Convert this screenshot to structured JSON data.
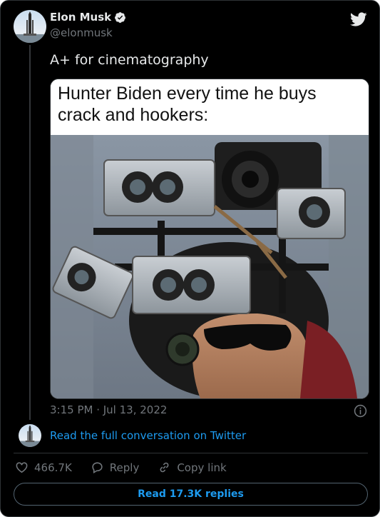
{
  "author": {
    "name": "Elon Musk",
    "handle": "@elonmusk",
    "verified": true,
    "avatar_icon": "rocket-launch-avatar"
  },
  "brand_icon": "twitter-bird-icon",
  "tweet": {
    "text": "A+ for cinematography",
    "media": {
      "caption": "Hunter Biden every time he buys crack and hookers:"
    },
    "timestamp": "3:15 PM · Jul 13, 2022"
  },
  "conversation_link": "Read the full conversation on Twitter",
  "actions": {
    "likes": "466.7K",
    "reply_label": "Reply",
    "copy_label": "Copy link"
  },
  "read_replies": "Read 17.3K replies",
  "colors": {
    "background": "#000000",
    "text": "#e7e9ea",
    "muted": "#71767b",
    "accent": "#1d9bf0",
    "border": "#2f3336"
  }
}
